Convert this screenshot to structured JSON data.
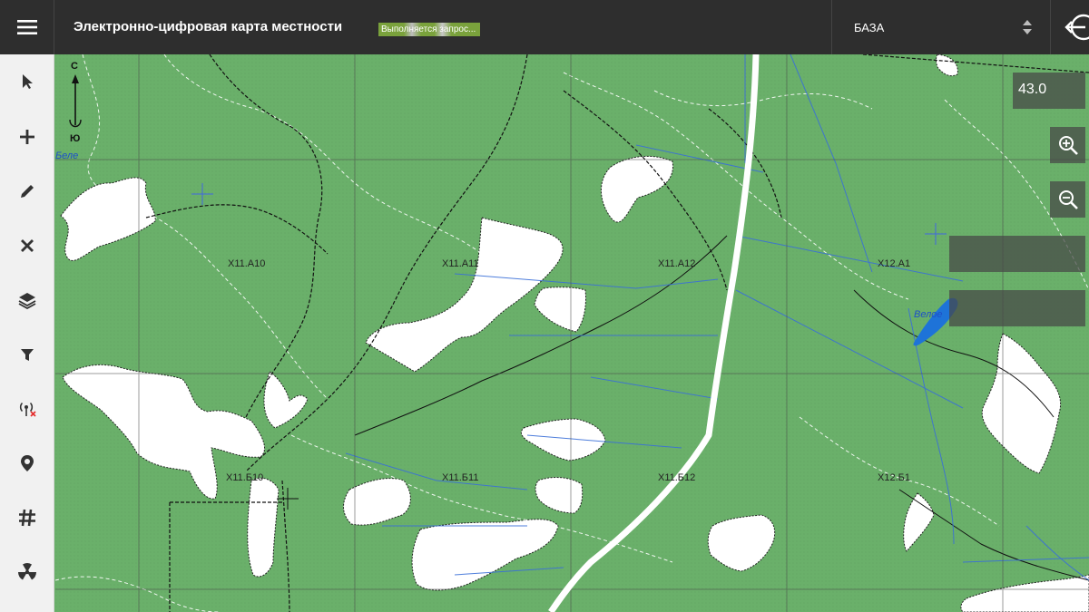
{
  "header": {
    "title": "Электронно-цифровая карта местности",
    "status": "Выполняется запрос...",
    "layer_select": {
      "value": "БАЗА"
    }
  },
  "toolbar": {
    "tools": [
      {
        "icon": "pointer-icon"
      },
      {
        "icon": "plus-icon"
      },
      {
        "icon": "pencil-icon"
      },
      {
        "icon": "close-icon"
      },
      {
        "icon": "layers-icon"
      },
      {
        "icon": "filter-icon"
      },
      {
        "icon": "signal-off-icon"
      },
      {
        "icon": "location-pin-icon"
      },
      {
        "icon": "grid-hash-icon"
      },
      {
        "icon": "radiation-icon"
      }
    ]
  },
  "map": {
    "zoom_level": "43.0",
    "compass": {
      "north": "С",
      "south": "Ю"
    },
    "sheet_labels": [
      "X11.А10",
      "X11.А11",
      "X11.А12",
      "X12.А1",
      "X11.Б10",
      "X11.Б11",
      "X11.Б12",
      "X12.Б1"
    ],
    "place_labels": [
      "Велое",
      "Беле"
    ],
    "colors": {
      "forest": "#6ab06a",
      "clearing": "#ffffff",
      "water": "#1e73d8",
      "grid": "#4a4a4a",
      "road": "#ffffff"
    }
  }
}
